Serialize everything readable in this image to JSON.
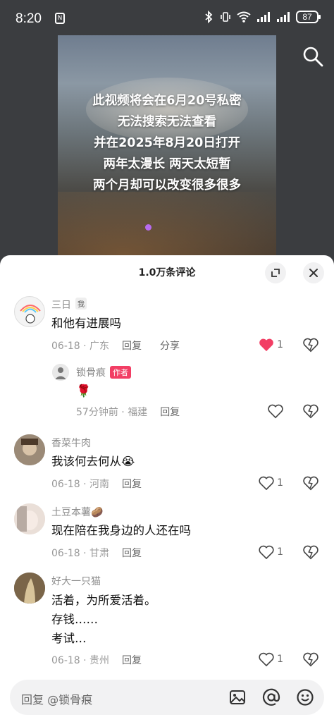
{
  "status": {
    "time": "8:20",
    "battery": "87"
  },
  "video": {
    "lines": [
      "此视频将会在6月20号私密",
      "无法搜索无法查看",
      "并在2025年8月20日打开",
      "两年太漫长 两天太短暂",
      "两个月却可以改变很多很多"
    ]
  },
  "sheet": {
    "title": "1.0万条评论"
  },
  "comments": [
    {
      "user": "三日",
      "tag": "我",
      "text": "和他有进展吗",
      "date": "06-18",
      "location": "广东",
      "reply": "回复",
      "share": "分享",
      "likes": "1"
    },
    {
      "user": "锁骨痕",
      "tag": "作者",
      "text": "🌹",
      "date": "57分钟前",
      "location": "福建",
      "reply": "回复"
    },
    {
      "user": "香菜牛肉",
      "text": "我该何去何从😭",
      "date": "06-18",
      "location": "河南",
      "reply": "回复",
      "likes": "1"
    },
    {
      "user": "土豆本薯🥔",
      "text": "现在陪在我身边的人还在吗",
      "date": "06-18",
      "location": "甘肃",
      "reply": "回复",
      "likes": "1"
    },
    {
      "user": "好大一只猫",
      "text_lines": [
        "活着，为所爱活着。",
        "存钱……",
        "考试…"
      ],
      "date": "06-18",
      "location": "贵州",
      "reply": "回复",
      "likes": "1"
    }
  ],
  "input": {
    "placeholder": "回复 @锁骨痕"
  },
  "colors": {
    "like_red": "#f23e64",
    "author_tag": "#f23e64"
  }
}
